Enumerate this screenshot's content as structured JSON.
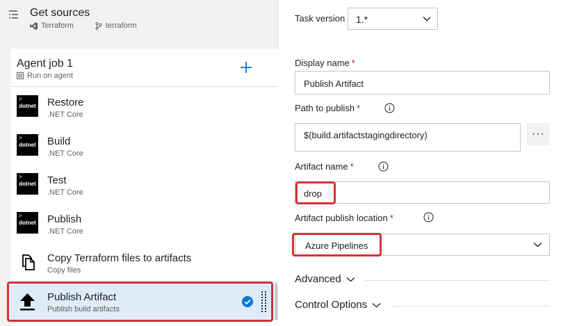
{
  "get_sources": {
    "title": "Get sources",
    "repo_type": "Terraform",
    "branch": "terraform"
  },
  "agent_job": {
    "title": "Agent job 1",
    "subtitle": "Run on agent"
  },
  "tasks": [
    {
      "name": "Restore",
      "subtitle": ".NET Core",
      "icon": "dotnet-icon",
      "icon_text": "dotnet"
    },
    {
      "name": "Build",
      "subtitle": ".NET Core",
      "icon": "dotnet-icon",
      "icon_text": "dotnet"
    },
    {
      "name": "Test",
      "subtitle": ".NET Core",
      "icon": "dotnet-icon",
      "icon_text": "dotnet"
    },
    {
      "name": "Publish",
      "subtitle": ".NET Core",
      "icon": "dotnet-icon",
      "icon_text": "dotnet"
    },
    {
      "name": "Copy Terraform files to artifacts",
      "subtitle": "Copy files",
      "icon": "copy-files-icon"
    },
    {
      "name": "Publish Artifact",
      "subtitle": "Publish build artifacts",
      "icon": "upload-icon",
      "selected": true
    }
  ],
  "form": {
    "task_version_label": "Task version",
    "task_version_value": "1.*",
    "display_name_label": "Display name",
    "display_name_value": "Publish Artifact",
    "path_label": "Path to publish",
    "path_value": "$(build.artifactstagingdirectory)",
    "more_button": "···",
    "artifact_name_label": "Artifact name",
    "artifact_name_value": "drop",
    "publish_location_label": "Artifact publish location",
    "publish_location_value": "Azure Pipelines",
    "required_marker": "*"
  },
  "sections": {
    "advanced": "Advanced",
    "control_options": "Control Options"
  },
  "colors": {
    "highlight_border": "#d13438",
    "selected_bg": "#deecf9",
    "accent": "#0078d4",
    "required": "#a4262c"
  }
}
